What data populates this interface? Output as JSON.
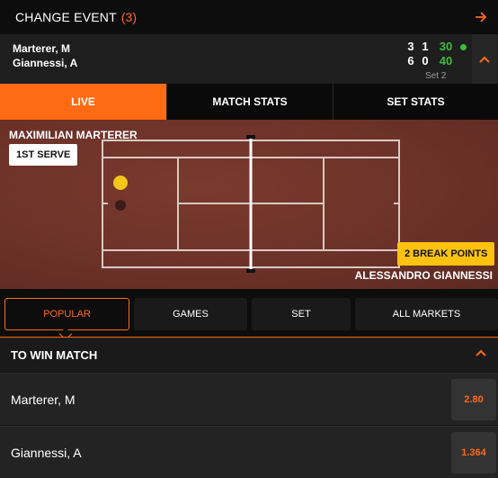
{
  "change_event": {
    "title": "CHANGE EVENT",
    "count": "(3)"
  },
  "scoreboard": {
    "players": [
      {
        "name": "Marterer, M",
        "sets": [
          "3",
          "1"
        ],
        "points": "30",
        "serving": true
      },
      {
        "name": "Giannessi, A",
        "sets": [
          "6",
          "0"
        ],
        "points": "40",
        "serving": false
      }
    ],
    "set_label": "Set 2"
  },
  "view_tabs": [
    {
      "label": "LIVE",
      "active": true
    },
    {
      "label": "MATCH STATS",
      "active": false
    },
    {
      "label": "SET STATS",
      "active": false
    }
  ],
  "court": {
    "player_top": "MAXIMILIAN MARTERER",
    "player_bottom": "ALESSANDRO GIANNESSI",
    "serve_badge": "1ST SERVE",
    "break_badge": "2 BREAK POINTS"
  },
  "market_tabs": [
    {
      "label": "POPULAR",
      "active": true
    },
    {
      "label": "GAMES",
      "active": false
    },
    {
      "label": "SET",
      "active": false
    },
    {
      "label": "ALL MARKETS",
      "active": false
    }
  ],
  "market": {
    "title": "TO WIN MATCH",
    "selections": [
      {
        "name": "Marterer, M",
        "odds": "2.80"
      },
      {
        "name": "Giannessi, A",
        "odds": "1.364"
      }
    ]
  },
  "colors": {
    "accent": "#ff6a13",
    "points_green": "#3bbf3b",
    "break_yellow": "#ffc20e",
    "court": "#6b3128"
  }
}
